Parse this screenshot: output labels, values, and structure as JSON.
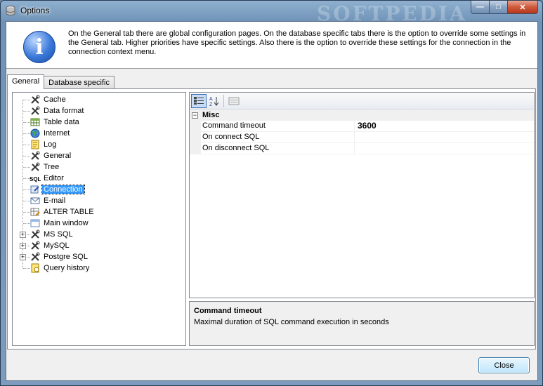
{
  "window": {
    "title": "Options",
    "watermark": "SOFTPEDIA",
    "min_glyph": "—",
    "max_glyph": "□",
    "close_glyph": "✕"
  },
  "info": {
    "text": "On the General tab there are global configuration pages. On the database specific tabs there is the option to override some settings in the General tab. Higher priorities have specific settings. Also there is the option to override these settings for the connection in the connection context menu."
  },
  "tabs": [
    {
      "label": "General",
      "active": true
    },
    {
      "label": "Database specific",
      "active": false
    }
  ],
  "tree": {
    "items": [
      {
        "label": "Cache",
        "icon": "tools-icon"
      },
      {
        "label": "Data format",
        "icon": "tools-icon"
      },
      {
        "label": "Table data",
        "icon": "table-icon"
      },
      {
        "label": "Internet",
        "icon": "globe-icon"
      },
      {
        "label": "Log",
        "icon": "log-icon"
      },
      {
        "label": "General",
        "icon": "tools-icon"
      },
      {
        "label": "Tree",
        "icon": "tools-icon"
      },
      {
        "label": "Editor",
        "icon": "sql-icon"
      },
      {
        "label": "Connection",
        "icon": "connection-icon",
        "selected": true
      },
      {
        "label": "E-mail",
        "icon": "email-icon"
      },
      {
        "label": "ALTER TABLE",
        "icon": "alter-table-icon"
      },
      {
        "label": "Main window",
        "icon": "window-icon"
      },
      {
        "label": "MS SQL",
        "icon": "tools-icon",
        "expandable": true
      },
      {
        "label": "MySQL",
        "icon": "tools-icon",
        "expandable": true
      },
      {
        "label": "Postgre SQL",
        "icon": "tools-icon",
        "expandable": true
      },
      {
        "label": "Query history",
        "icon": "history-icon"
      }
    ]
  },
  "props": {
    "category": "Misc",
    "rows": [
      {
        "name": "Command timeout",
        "value": "3600"
      },
      {
        "name": "On connect SQL",
        "value": ""
      },
      {
        "name": "On disconnect SQL",
        "value": ""
      }
    ]
  },
  "description": {
    "title": "Command timeout",
    "text": "Maximal duration of SQL command execution in seconds"
  },
  "buttons": {
    "close_label": "Close"
  }
}
